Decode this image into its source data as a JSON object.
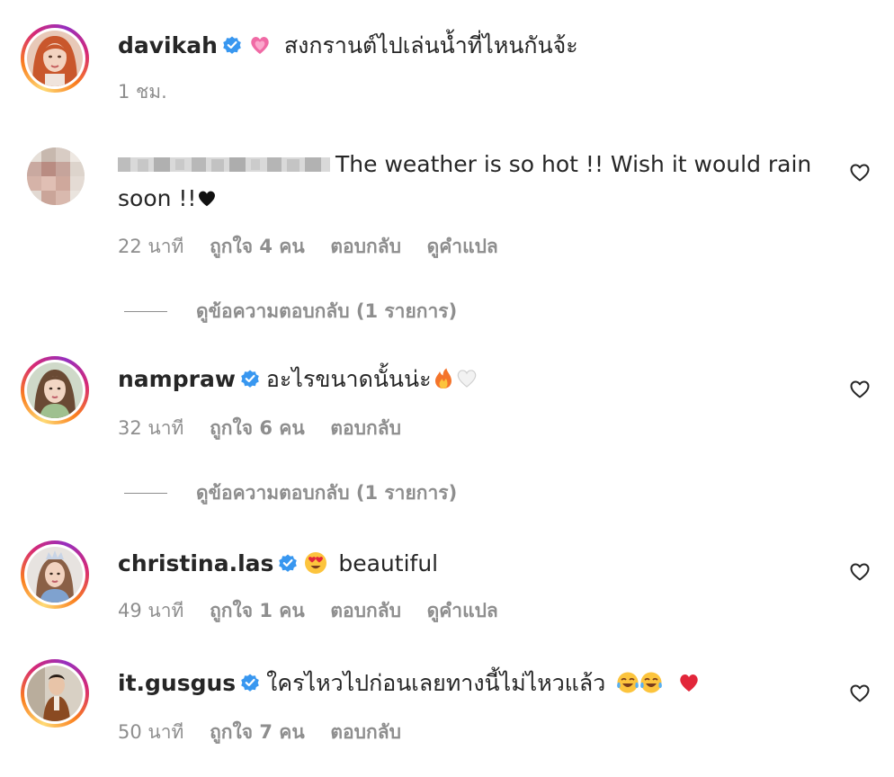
{
  "comments": [
    {
      "username": "davikah",
      "verified": true,
      "text": "สงกรานต์ไปเล่นน้ำที่ไหนกันจ้ะ",
      "time": "1 ชม."
    },
    {
      "username": "",
      "text_line1": "The weather is so hot !! Wish it would rain",
      "text_line2": "soon !!",
      "time": "22 นาที",
      "likes": "ถูกใจ 4 คน",
      "reply": "ตอบกลับ",
      "translate": "ดูคำแปล",
      "view_replies": "ดูข้อความตอบกลับ (1 รายการ)"
    },
    {
      "username": "nampraw",
      "verified": true,
      "text": "อะไรขนาดนั้นน่ะ",
      "time": "32 นาที",
      "likes": "ถูกใจ 6 คน",
      "reply": "ตอบกลับ",
      "view_replies": "ดูข้อความตอบกลับ (1 รายการ)"
    },
    {
      "username": "christina.las",
      "verified": true,
      "text": "beautiful",
      "time": "49 นาที",
      "likes": "ถูกใจ 1 คน",
      "reply": "ตอบกลับ",
      "translate": "ดูคำแปล"
    },
    {
      "username": "it.gusgus",
      "verified": true,
      "text": "ใครไหวไปก่อนเลยทางนี้ไม่ไหวแล้ว",
      "time": "50 นาที",
      "likes": "ถูกใจ 7 คน",
      "reply": "ตอบกลับ"
    }
  ],
  "colors": {
    "verified_blue": "#3897f0",
    "meta_gray": "#8e8e8e",
    "text": "#262626"
  }
}
